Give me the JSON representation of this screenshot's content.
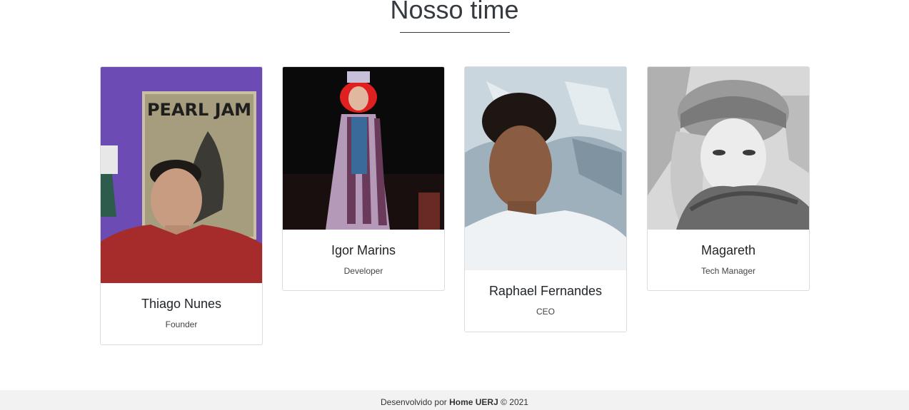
{
  "section": {
    "title": "Nosso time"
  },
  "team": [
    {
      "name": "Thiago Nunes",
      "role": "Founder",
      "photo": "portrait-photo"
    },
    {
      "name": "Igor Marins",
      "role": "Developer",
      "photo": "portrait-photo"
    },
    {
      "name": "Raphael Fernandes",
      "role": "CEO",
      "photo": "portrait-photo"
    },
    {
      "name": "Magareth",
      "role": "Tech Manager",
      "photo": "portrait-photo"
    }
  ],
  "poster_text": "PEARL JAM",
  "footer": {
    "prefix": "Desenvolvido por",
    "brand": "Home UERJ",
    "suffix": "© 2021"
  }
}
